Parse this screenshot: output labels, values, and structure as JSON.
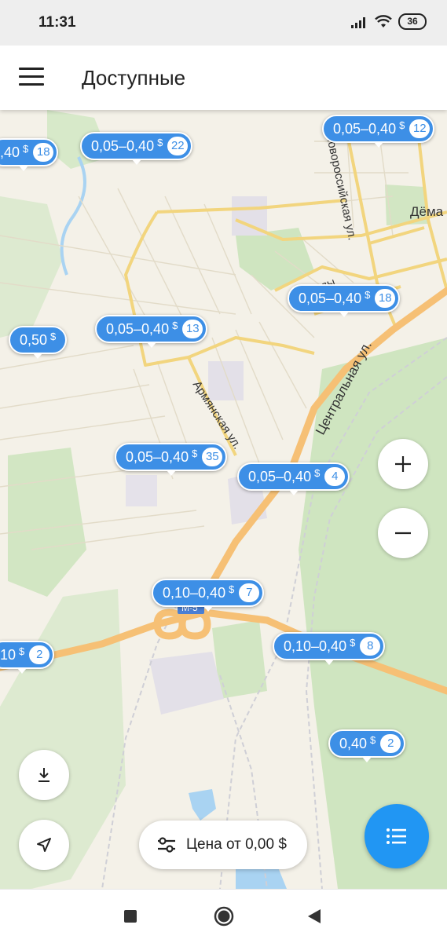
{
  "status_bar": {
    "time": "11:31",
    "battery": "36"
  },
  "app_bar": {
    "title": "Доступные"
  },
  "map": {
    "street_labels": [
      {
        "text": "Центральная ул."
      },
      {
        "text": "Армянская ул."
      },
      {
        "text": "Новороссийская ул."
      },
      {
        "text": "Правды"
      },
      {
        "text": "Дёма"
      },
      {
        "text": "М-5"
      }
    ]
  },
  "pins": [
    {
      "price": "0,05–0,40",
      "currency": "$",
      "count": "12"
    },
    {
      "price": "0,05–0,40",
      "currency": "$",
      "count": "22"
    },
    {
      "price": ",40",
      "currency": "$",
      "count": "18"
    },
    {
      "price": "0,05–0,40",
      "currency": "$",
      "count": "18"
    },
    {
      "price": "0,05–0,40",
      "currency": "$",
      "count": "13"
    },
    {
      "price": "0,50",
      "currency": "$",
      "count": ""
    },
    {
      "price": "0,05–0,40",
      "currency": "$",
      "count": "35"
    },
    {
      "price": "0,05–0,40",
      "currency": "$",
      "count": "4"
    },
    {
      "price": "0,10–0,40",
      "currency": "$",
      "count": "7"
    },
    {
      "price": "10",
      "currency": "$",
      "count": "2"
    },
    {
      "price": "0,10–0,40",
      "currency": "$",
      "count": "8"
    },
    {
      "price": "0,40",
      "currency": "$",
      "count": "2"
    }
  ],
  "price_filter": {
    "label": "Цена от 0,00 $"
  },
  "colors": {
    "accent": "#2196f3",
    "pin": "#3d8fe6",
    "road_major": "#f6c075",
    "road_yellow": "#f2d57e",
    "park": "#cfe5c0",
    "map_bg": "#f4f1e8"
  }
}
